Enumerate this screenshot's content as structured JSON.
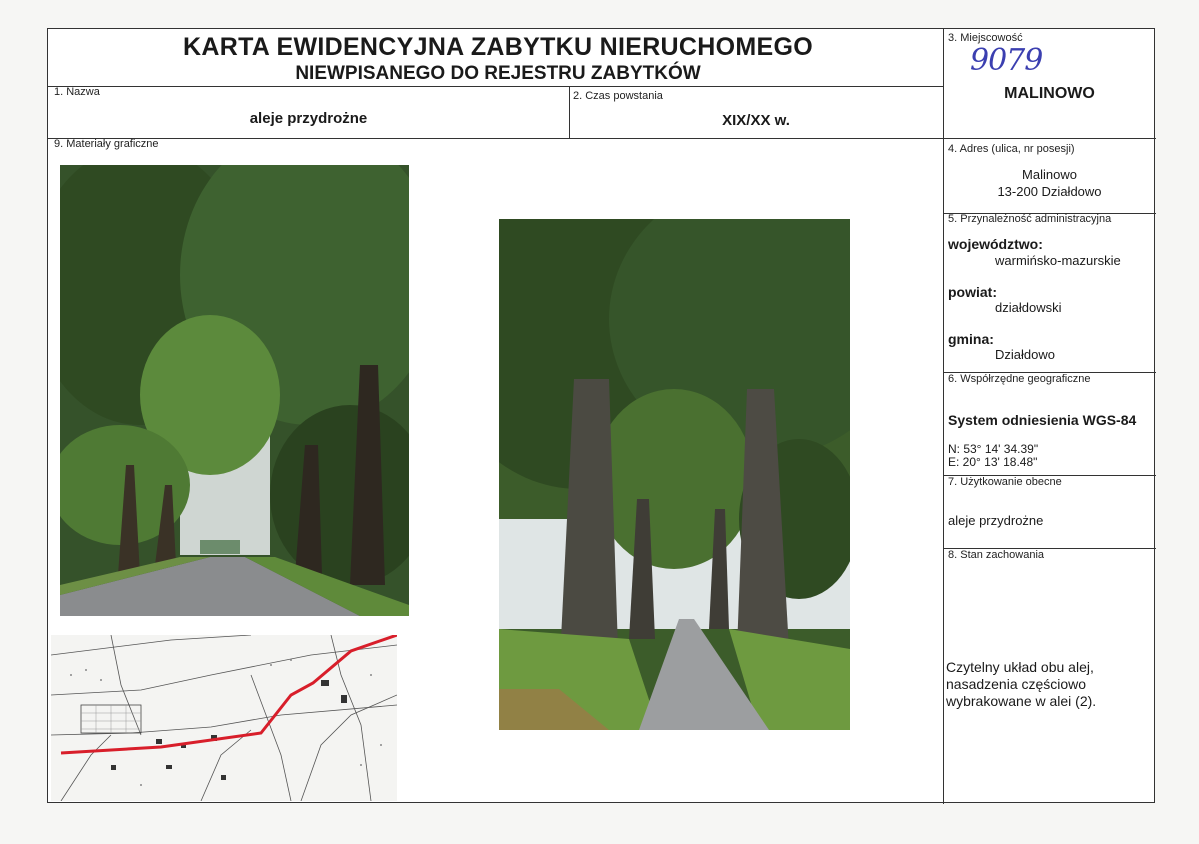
{
  "header": {
    "title_line1": "KARTA EWIDENCYJNA ZABYTKU NIERUCHOMEGO",
    "title_line2": "NIEWPISANEGO DO REJESTRU ZABYTKÓW"
  },
  "fields": {
    "nazwa": {
      "label": "1. Nazwa",
      "value": "aleje przydrożne"
    },
    "czas_powstania": {
      "label": "2. Czas powstania",
      "value": "XIX/XX w."
    },
    "miejscowosc": {
      "label": "3. Miejscowość",
      "handwritten_number": "9079",
      "value": "MALINOWO"
    },
    "adres": {
      "label": "4. Adres (ulica, nr posesji)",
      "line1": "Malinowo",
      "line2": "13-200 Działdowo"
    },
    "przynaleznosc": {
      "label": "5. Przynależność administracyjna",
      "wojewodztwo_label": "województwo:",
      "wojewodztwo": "warmińsko-mazurskie",
      "powiat_label": "powiat:",
      "powiat": "działdowski",
      "gmina_label": "gmina:",
      "gmina": "Działdowo"
    },
    "wspolrzedne": {
      "label": "6. Współrzędne geograficzne",
      "system": "System odniesienia WGS-84",
      "n": "N: 53° 14' 34.39\"",
      "e": "E: 20° 13' 18.48\""
    },
    "uzytkowanie": {
      "label": "7. Użytkowanie obecne",
      "value": "aleje przydrożne"
    },
    "stan": {
      "label": "8. Stan zachowania",
      "line1": "Czytelny układ obu alej,",
      "line2": "nasadzenia częściowo",
      "line3": "wybrakowane w alei (2)."
    },
    "materialy": {
      "label": "9. Materiały graficzne"
    }
  },
  "colors": {
    "foliage_dark": "#2f4a22",
    "foliage_mid": "#4f7a34",
    "sky": "#e9ecea",
    "road": "#8a8c8e",
    "map_route": "#d81e2a"
  }
}
